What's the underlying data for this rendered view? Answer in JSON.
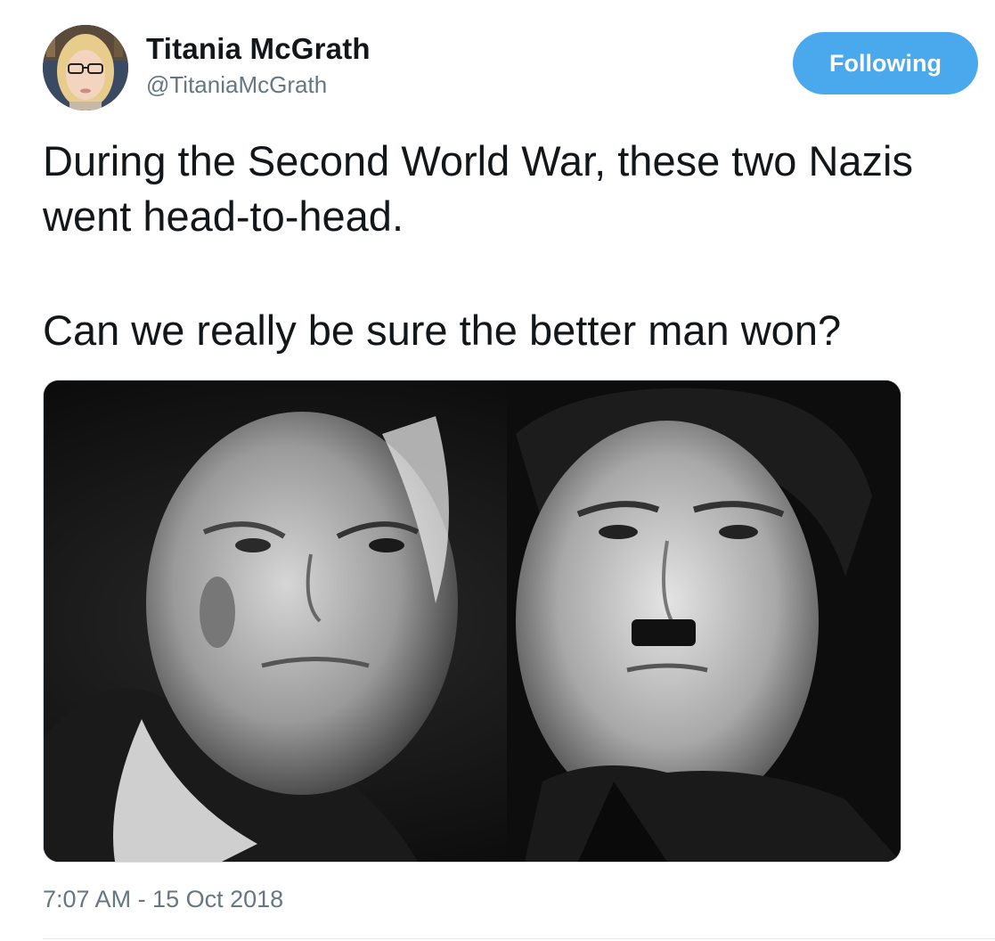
{
  "user": {
    "display_name": "Titania McGrath",
    "handle": "@TitaniaMcGrath",
    "avatar_icon": "avatar-photo"
  },
  "follow_button": {
    "label": "Following",
    "color": "#4aa8ec"
  },
  "tweet": {
    "paragraphs": [
      "During the Second World War, these two Nazis went head-to-head.",
      "Can we really be sure the better man won?"
    ],
    "timestamp": "7:07 AM - 15 Oct 2018"
  },
  "media": {
    "kind": "black-and-white photo of two men side by side"
  },
  "colors": {
    "text": "#14171a",
    "secondary": "#657786",
    "accent": "#4aa8ec"
  }
}
